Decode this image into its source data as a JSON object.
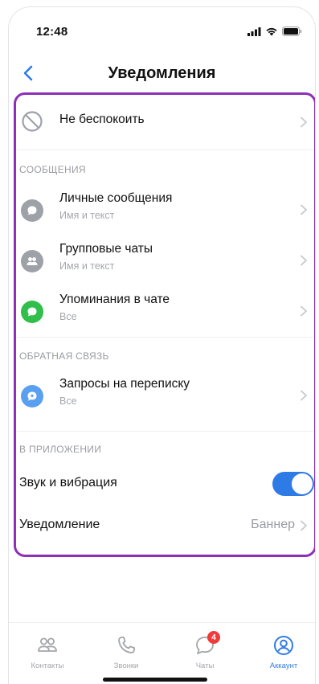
{
  "status_bar": {
    "time": "12:48"
  },
  "header": {
    "title": "Уведомления"
  },
  "dnd": {
    "label": "Не беспокоить"
  },
  "sections": {
    "messages": "СООБЩЕНИЯ",
    "feedback": "ОБРАТНАЯ СВЯЗЬ",
    "in_app": "В ПРИЛОЖЕНИИ"
  },
  "message_items": [
    {
      "title": "Личные сообщения",
      "subtitle": "Имя и текст"
    },
    {
      "title": "Групповые чаты",
      "subtitle": "Имя и текст"
    },
    {
      "title": "Упоминания в чате",
      "subtitle": "Все"
    }
  ],
  "feedback_items": [
    {
      "title": "Запросы на переписку",
      "subtitle": "Все"
    }
  ],
  "in_app": {
    "sound_label": "Звук и вибрация",
    "sound_enabled": true,
    "notification_label": "Уведомление",
    "notification_value": "Баннер"
  },
  "tab_bar": {
    "items": [
      {
        "label": "Контакты"
      },
      {
        "label": "Звонки"
      },
      {
        "label": "Чаты",
        "badge": "4"
      },
      {
        "label": "Аккаунт"
      }
    ],
    "active": "Аккаунт"
  },
  "colors": {
    "accent": "#2f7be6",
    "highlight_border": "#8e2fb8",
    "badge": "#ef3b3b",
    "mention_icon": "#2fbf4a",
    "request_icon": "#5aa0f0",
    "grey_icon": "#9ea1a8"
  }
}
